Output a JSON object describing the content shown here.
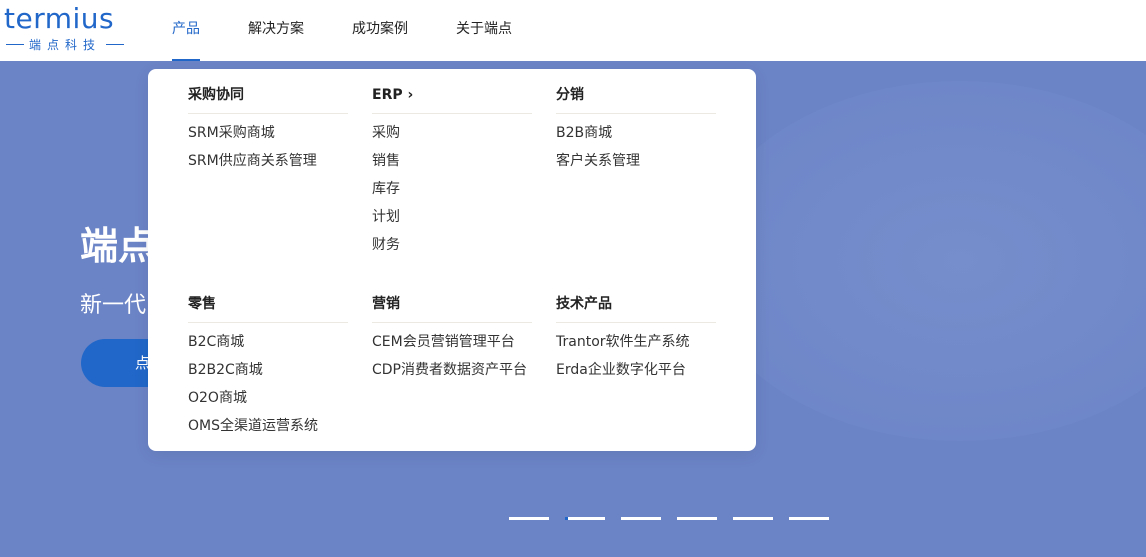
{
  "logo": {
    "word": "termius",
    "sub": "端点科技"
  },
  "nav": {
    "items": [
      "产品",
      "解决方案",
      "成功案例",
      "关于端点"
    ],
    "active_index": 0
  },
  "hero": {
    "title": "端点",
    "subtitle": "新一代",
    "button_label": "点"
  },
  "dropdown": {
    "groups": [
      {
        "title": "采购协同",
        "items": [
          "SRM采购商城",
          "SRM供应商关系管理"
        ]
      },
      {
        "title": "ERP",
        "title_suffix": "›",
        "items": [
          "采购",
          "销售",
          "库存",
          "计划",
          "财务"
        ]
      },
      {
        "title": "分销",
        "items": [
          "B2B商城",
          "客户关系管理"
        ]
      },
      {
        "title": "零售",
        "items": [
          "B2C商城",
          "B2B2C商城",
          "O2O商城",
          "OMS全渠道运营系统"
        ]
      },
      {
        "title": "营销",
        "items": [
          "CEM会员营销管理平台",
          "CDP消费者数据资产平台"
        ]
      },
      {
        "title": "技术产品",
        "items": [
          "Trantor软件生产系统",
          "Erda企业数字化平台"
        ]
      }
    ]
  },
  "carousel": {
    "count": 6,
    "active_index": 1
  },
  "colors": {
    "brand": "#2167c9",
    "hero_bg": "#6b84c6"
  }
}
